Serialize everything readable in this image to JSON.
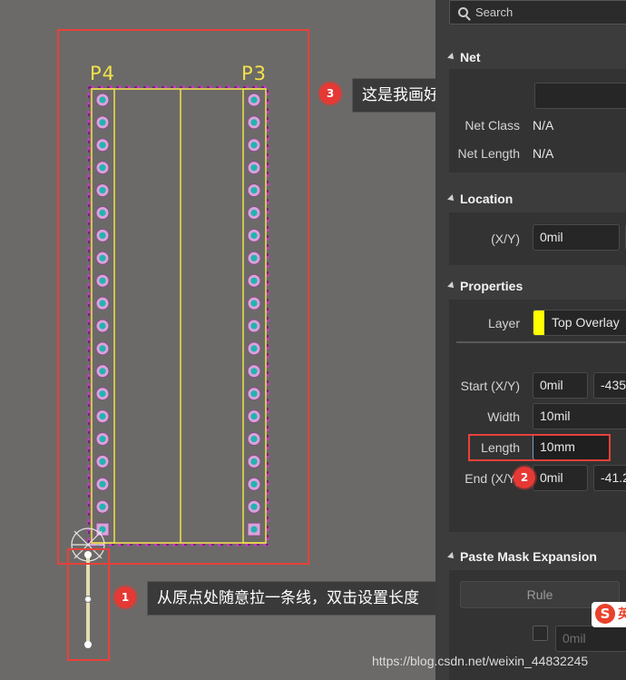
{
  "canvas": {
    "designators": [
      "P4",
      "P3"
    ],
    "callouts": [
      {
        "num": "1",
        "text": "从原点处随意拉一条线，双击设置长度"
      },
      {
        "num": "2"
      },
      {
        "num": "3",
        "text": "这是我画好辅助线之后的板子"
      }
    ]
  },
  "panel": {
    "search_placeholder": "Search",
    "net": {
      "header": "Net",
      "net_class_label": "Net Class",
      "net_class_value": "N/A",
      "net_length_label": "Net Length",
      "net_length_value": "N/A"
    },
    "location": {
      "header": "Location",
      "xy_label": "(X/Y)",
      "x_value": "0mil"
    },
    "properties": {
      "header": "Properties",
      "layer_label": "Layer",
      "layer_value": "Top Overlay",
      "layer_color": "#ffff00",
      "start_label": "Start (X/Y)",
      "start_x": "0mil",
      "start_y": "-435",
      "width_label": "Width",
      "width_value": "10mil",
      "length_label": "Length",
      "length_value": "10mm",
      "end_label": "End (X/Y)",
      "end_x": "0mil",
      "end_y": "-41.2"
    },
    "paste_mask": {
      "header": "Paste Mask Expansion",
      "rule_label": "Rule",
      "value": "0mil"
    }
  },
  "watermark": "https://blog.csdn.net/weixin_44832245",
  "logo_text": "英",
  "colors": {
    "badge": "#e53935",
    "highlight_box": "#e8413a",
    "overlay_yellow": "#f0e24a",
    "keepout_magenta": "#cc33cc",
    "pad_cyan": "#22b3b0"
  }
}
